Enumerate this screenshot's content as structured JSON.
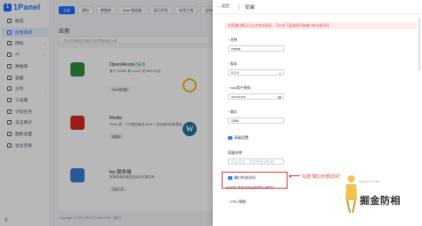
{
  "sidebar": {
    "logo_mark": "1",
    "logo_text": "1Panel",
    "items": [
      {
        "label": "概览",
        "active": false,
        "caret": false
      },
      {
        "label": "应用商店",
        "active": true,
        "caret": false
      },
      {
        "label": "网站",
        "active": false,
        "caret": true
      },
      {
        "label": "AI",
        "active": false,
        "caret": true
      },
      {
        "label": "数据库",
        "active": false,
        "caret": false
      },
      {
        "label": "容器",
        "active": false,
        "caret": false
      },
      {
        "label": "主机",
        "active": false,
        "caret": true
      },
      {
        "label": "工具箱",
        "active": false,
        "caret": false
      },
      {
        "label": "计划任务",
        "active": false,
        "caret": false
      },
      {
        "label": "日志审计",
        "active": false,
        "caret": false
      },
      {
        "label": "面板设置",
        "active": false,
        "caret": false
      },
      {
        "label": "退出登录",
        "active": false,
        "caret": false
      }
    ],
    "collapse_icon": "≡"
  },
  "tabs": [
    {
      "label": "全部",
      "active": true
    },
    {
      "label": "建站",
      "active": false
    },
    {
      "label": "数据库",
      "active": false
    },
    {
      "label": "Web 服务器",
      "active": false
    },
    {
      "label": "运行环境",
      "active": false
    },
    {
      "label": "实用工具",
      "active": false
    },
    {
      "label": "云存储",
      "active": false
    }
  ],
  "section_title": "应用",
  "toolbar_hint": "请从应用商店安装应用后再使用此功能",
  "apps": [
    {
      "name": "OpenResty",
      "status": "已安装",
      "desc": "基于 NGINX 和 LuaJIT 的 Web 平台",
      "tag": "Web 服务器"
    },
    {
      "name": "Redis",
      "status": "",
      "desc": "Redis 是一个开源的使用 ANSI C 语言编写的数据库",
      "tag": "数据库"
    },
    {
      "name": "frp 服务端",
      "status": "",
      "desc": "简单易用的高性能反向代理应用",
      "tag": "实用工具"
    }
  ],
  "copyright": "Copyright © 2014-2024 FIT2CLOUD 飞致云",
  "drawer": {
    "back_label": "返回",
    "title": "安装",
    "alert": "应用端口默认只允许本机访问，可以在下面选择开放端口给外部访问",
    "fields": [
      {
        "label": "名称",
        "value": "mysql",
        "type": "text"
      },
      {
        "label": "版本",
        "value": "8.2.0",
        "type": "select"
      },
      {
        "label": "root用户密码",
        "value": "••••••••••••",
        "type": "password"
      },
      {
        "label": "端口",
        "value": "3306",
        "type": "text"
      }
    ],
    "advanced_label": "高级设置",
    "container_label": "容器名称",
    "container_placeholder": "可以为空，为空将自动生成",
    "external_label": "端口外部访问",
    "external_help": "允许端口外部访问会放开防火墙端口",
    "cpu_label": "CPU 限制"
  },
  "annotation": "勾选\"端口外部访问\"",
  "watermark": {
    "text": "掘金防相",
    "sub": "xyyooo.com"
  },
  "colors": {
    "brand": "#1d6dff",
    "success": "#21a564",
    "danger": "#e53935",
    "alert_bg": "#fdecec"
  }
}
